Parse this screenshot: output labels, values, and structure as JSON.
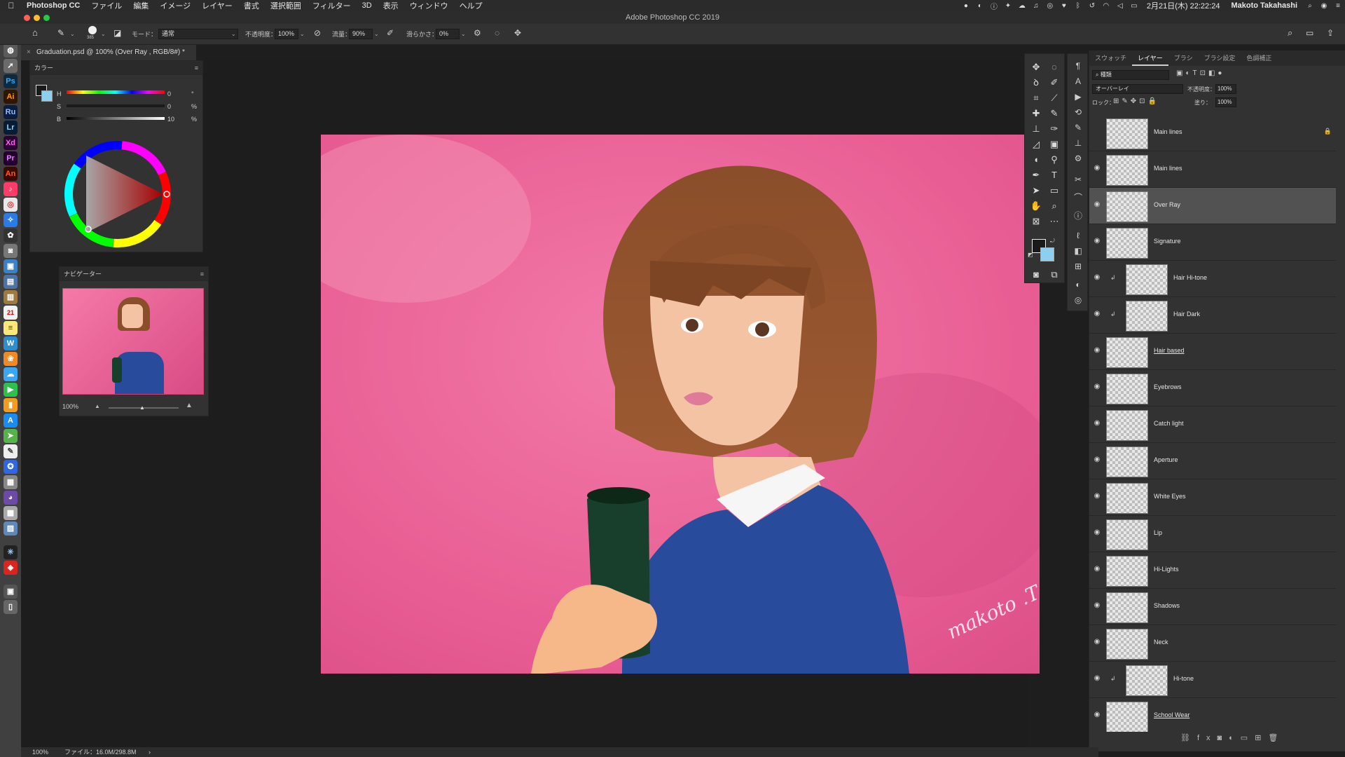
{
  "menubar": {
    "app_name": "Photoshop CC",
    "items": [
      "ファイル",
      "編集",
      "イメージ",
      "レイヤー",
      "書式",
      "選択範囲",
      "フィルター",
      "3D",
      "表示",
      "ウィンドウ",
      "ヘルプ"
    ],
    "clock": "2月21日(木)  22:22:24",
    "user": "Makoto Takahashi"
  },
  "window": {
    "title": "Adobe Photoshop CC 2019"
  },
  "options_bar": {
    "brush_size": "385",
    "mode_label": "モード：",
    "mode_value": "通常",
    "opacity_label": "不透明度：",
    "opacity_value": "100%",
    "flow_label": "流量：",
    "flow_value": "90%",
    "smoothing_label": "滑らかさ：",
    "smoothing_value": "0%"
  },
  "document": {
    "tab_title": "Graduation.psd @ 100% (Over Ray , RGB/8#) *",
    "signature": "makoto .T"
  },
  "color_panel": {
    "title": "カラー",
    "sliders": [
      {
        "label": "H",
        "value": "0",
        "unit": "°"
      },
      {
        "label": "S",
        "value": "0",
        "unit": "%"
      },
      {
        "label": "B",
        "value": "10",
        "unit": "%"
      }
    ],
    "foreground": "#1a1a1a",
    "background": "#8ccfee"
  },
  "navigator_panel": {
    "title": "ナビゲーター",
    "zoom": "100%"
  },
  "layers_panel": {
    "tabs": [
      "スウォッチ",
      "レイヤー",
      "ブラシ",
      "ブラシ設定",
      "色調補正"
    ],
    "active_tab": "レイヤー",
    "filter_kind": "種類",
    "blend_mode": "オーバーレイ",
    "opacity_label": "不透明度：",
    "opacity_value": "100%",
    "lock_label": "ロック：",
    "fill_label": "塗り：",
    "fill_value": "100%",
    "layers": [
      {
        "name": "Main lines",
        "visible": false,
        "locked": true,
        "clipped": false,
        "selected": false
      },
      {
        "name": "Main lines",
        "visible": true,
        "locked": false,
        "clipped": false,
        "selected": false
      },
      {
        "name": "Over Ray",
        "visible": true,
        "locked": false,
        "clipped": false,
        "selected": true
      },
      {
        "name": "Signature",
        "visible": true,
        "locked": false,
        "clipped": false,
        "selected": false
      },
      {
        "name": "Hair Hi-tone",
        "visible": true,
        "locked": false,
        "clipped": true,
        "selected": false
      },
      {
        "name": "Hair Dark",
        "visible": true,
        "locked": false,
        "clipped": true,
        "selected": false
      },
      {
        "name": "Hair based",
        "visible": true,
        "locked": false,
        "clipped": false,
        "selected": false,
        "underline": true
      },
      {
        "name": "Eyebrows",
        "visible": true,
        "locked": false,
        "clipped": false,
        "selected": false
      },
      {
        "name": "Catch light",
        "visible": true,
        "locked": false,
        "clipped": false,
        "selected": false
      },
      {
        "name": "Aperture",
        "visible": true,
        "locked": false,
        "clipped": false,
        "selected": false
      },
      {
        "name": "White Eyes",
        "visible": true,
        "locked": false,
        "clipped": false,
        "selected": false
      },
      {
        "name": "Lip",
        "visible": true,
        "locked": false,
        "clipped": false,
        "selected": false
      },
      {
        "name": "Hi-Lights",
        "visible": true,
        "locked": false,
        "clipped": false,
        "selected": false
      },
      {
        "name": "Shadows",
        "visible": true,
        "locked": false,
        "clipped": false,
        "selected": false
      },
      {
        "name": "Neck",
        "visible": true,
        "locked": false,
        "clipped": false,
        "selected": false
      },
      {
        "name": "Hi-tone",
        "visible": true,
        "locked": false,
        "clipped": true,
        "selected": false
      },
      {
        "name": "School Wear",
        "visible": true,
        "locked": false,
        "clipped": false,
        "selected": false,
        "underline": true
      }
    ]
  },
  "status_bar": {
    "zoom": "100%",
    "file_info": "ファイル：16.0M/298.8M"
  },
  "dock_apps": [
    "Ps",
    "Ai",
    "Ru",
    "Lr",
    "Xd",
    "Pr",
    "An"
  ]
}
